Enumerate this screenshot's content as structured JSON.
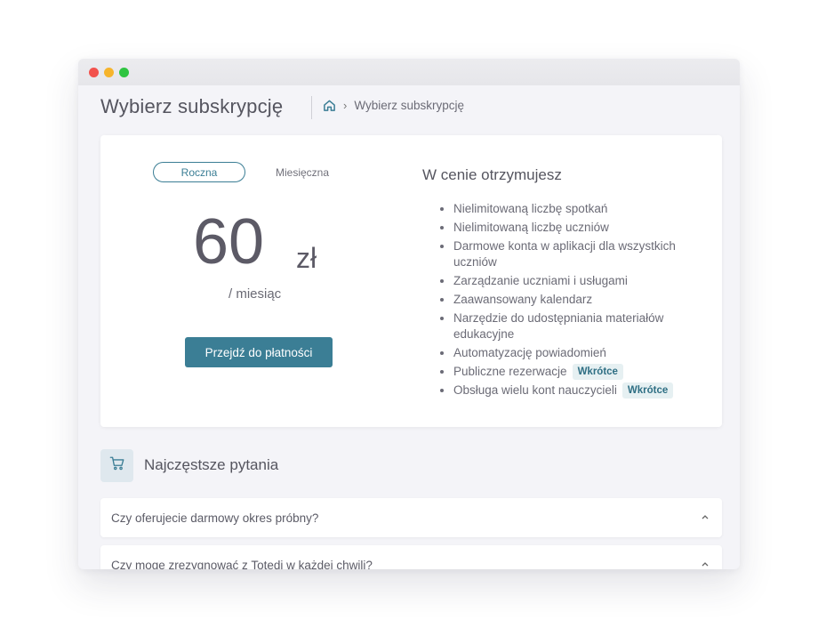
{
  "header": {
    "title": "Wybierz subskrypcję",
    "breadcrumb": {
      "home_icon": "home-icon",
      "separator": "›",
      "current": "Wybierz subskrypcję"
    }
  },
  "plan": {
    "tabs": {
      "yearly": "Roczna",
      "monthly": "Miesięczna",
      "selected": "Roczna"
    },
    "price": "60",
    "currency": "zł",
    "period": "/ miesiąc",
    "button": "Przejdź do płatności"
  },
  "features": {
    "heading": "W cenie otrzymujesz",
    "items": [
      {
        "text": "Nielimitowaną liczbę spotkań",
        "badge": ""
      },
      {
        "text": "Nielimitowaną liczbę uczniów",
        "badge": ""
      },
      {
        "text": "Darmowe konta w aplikacji dla wszystkich uczniów",
        "badge": ""
      },
      {
        "text": "Zarządzanie uczniami i usługami",
        "badge": ""
      },
      {
        "text": "Zaawansowany kalendarz",
        "badge": ""
      },
      {
        "text": "Narzędzie do udostępniania materiałów edukacyjne",
        "badge": ""
      },
      {
        "text": "Automatyzację powiadomień",
        "badge": ""
      },
      {
        "text": "Publiczne rezerwacje",
        "badge": "Wkrótce"
      },
      {
        "text": "Obsługa wielu kont nauczycieli",
        "badge": "Wkrótce"
      }
    ]
  },
  "faq": {
    "icon": "cart-icon",
    "title": "Najczęstsze pytania",
    "items": [
      {
        "question": "Czy oferujecie darmowy okres próbny?"
      },
      {
        "question": "Czy mogę zrezygnować z Totedi w każdej chwili?"
      }
    ]
  },
  "colors": {
    "accent": "#3b7e95",
    "badge_bg": "#e6f0f2",
    "page_bg": "#f4f4f8"
  }
}
